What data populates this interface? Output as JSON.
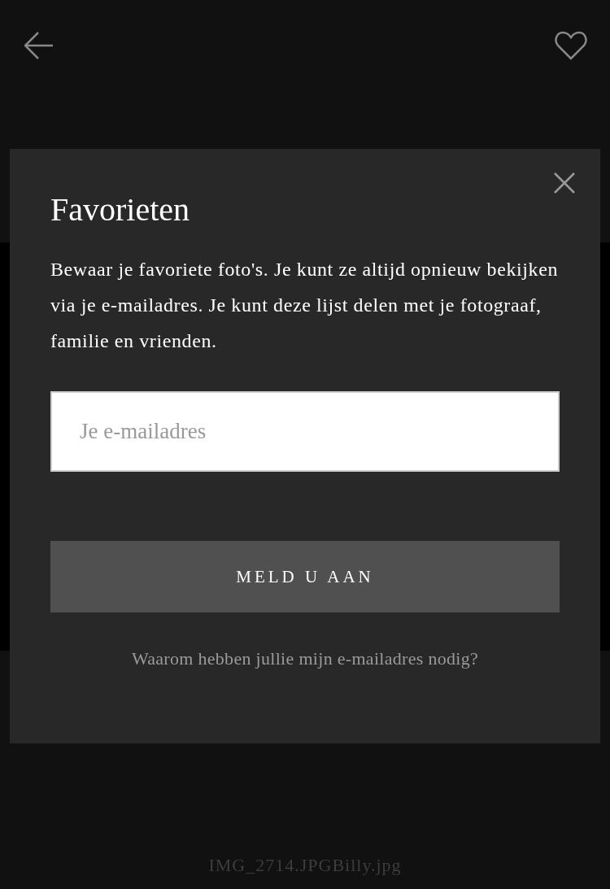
{
  "header": {
    "back": true,
    "favorite": false
  },
  "photo": {
    "filename": "IMG_2714.JPGBilly.jpg"
  },
  "modal": {
    "title": "Favorieten",
    "description": "Bewaar je favoriete foto's. Je kunt ze altijd opnieuw bekijken via je e-mailadres. Je kunt deze lijst delen met je fotograaf, familie en vrienden.",
    "email_field": {
      "placeholder": "Je e-mailadres"
    },
    "submit_button": "MELD U AAN",
    "help_link": "Waarom hebben jullie mijn e-mailadres nodig?"
  }
}
